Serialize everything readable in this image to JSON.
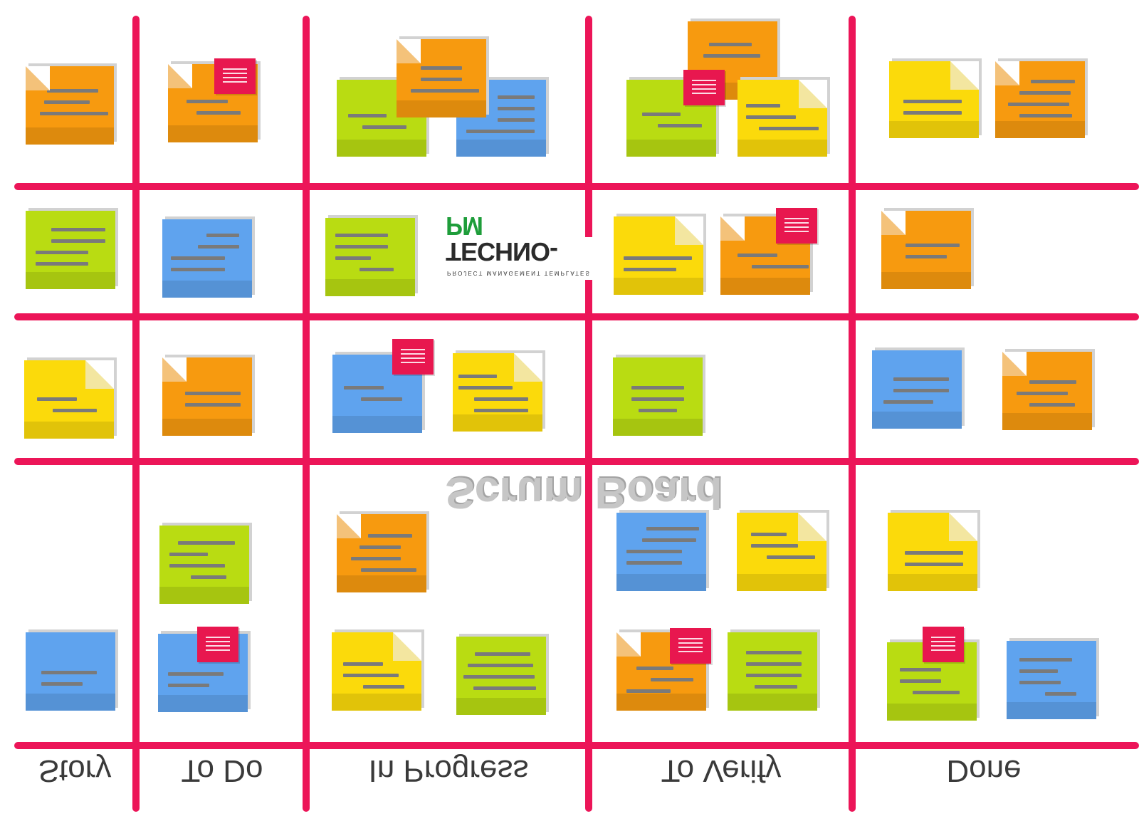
{
  "board": {
    "title": "Scrum Board",
    "logo": {
      "name": "TECHNO-",
      "name_accent": "PM",
      "tagline": "PROJECT MANAGEMENT TEMPLATES"
    },
    "columns": [
      "Story",
      "To Do",
      "In Progress",
      "To Verify",
      "Done"
    ],
    "rows": 4,
    "note_counts_by_row": [
      [
        1,
        1,
        3,
        3,
        2
      ],
      [
        1,
        1,
        1,
        2,
        1
      ],
      [
        1,
        1,
        2,
        1,
        2
      ],
      [
        1,
        2,
        3,
        4,
        3
      ]
    ],
    "red_flags": 7
  },
  "colors": {
    "grid": "#ec1558",
    "orange": "#f79a0f",
    "green": "#b9dc12",
    "blue": "#5fa3ee",
    "yellow": "#fbda0b",
    "flag": "#e8174f",
    "text": "#3a3a3a",
    "logo_accent": "#1e9d3a"
  }
}
